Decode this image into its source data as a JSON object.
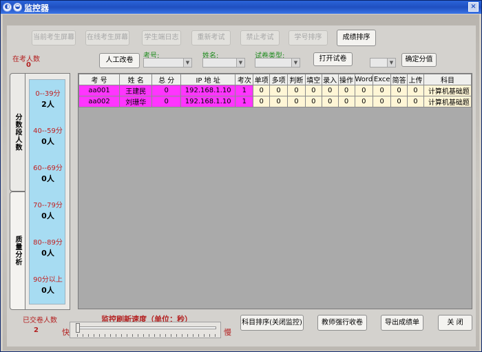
{
  "window": {
    "title": "监控器"
  },
  "toolbar": {
    "current_screen": "当前考生屏幕",
    "online_screen": "在线考生屏幕",
    "student_log": "学生端日志",
    "restart_exam": "重新考试",
    "stop_exam": "禁止考试",
    "id_sort": "学号排序",
    "score_sort": "成绩排序"
  },
  "status": {
    "in_exam_label": "在考人数",
    "in_exam_count": "0",
    "submitted_label": "已交卷人数",
    "submitted_count": "2"
  },
  "filters": {
    "manual_grade": "人工改卷",
    "exam_id_label": "考号:",
    "name_label": "姓名:",
    "paper_type_label": "试卷类型:",
    "open_paper": "打开试卷",
    "confirm_score": "确定分值"
  },
  "tabs": {
    "score_band": "分数段人数",
    "quality": "质量分析"
  },
  "score_bands": [
    {
      "range": "0--39分",
      "count": "2人"
    },
    {
      "range": "40--59分",
      "count": "0人"
    },
    {
      "range": "60--69分",
      "count": "0人"
    },
    {
      "range": "70--79分",
      "count": "0人"
    },
    {
      "range": "80--89分",
      "count": "0人"
    },
    {
      "range": "90分以上",
      "count": "0人"
    }
  ],
  "table": {
    "headers": [
      "考 号",
      "姓 名",
      "总 分",
      "IP 地 址",
      "考次",
      "单项",
      "多项",
      "判断",
      "填空",
      "录入",
      "操作",
      "Word",
      "Exce",
      "简答",
      "上传",
      "科目"
    ],
    "rows": [
      [
        "aa001",
        "王建民",
        "0",
        "192.168.1.10",
        "1",
        "0",
        "0",
        "0",
        "0",
        "0",
        "0",
        "0",
        "0",
        "0",
        "0",
        "计算机基础题"
      ],
      [
        "aa002",
        "刘珊华",
        "0",
        "192.168.1.10",
        "1",
        "0",
        "0",
        "0",
        "0",
        "0",
        "0",
        "0",
        "0",
        "0",
        "0",
        "计算机基础题"
      ]
    ]
  },
  "speed": {
    "label": "监控刷新速度（单位：秒）",
    "fast": "快",
    "slow": "慢"
  },
  "bottom_buttons": {
    "subject_sort": "科目排序(关闭监控)",
    "force_collect": "教师强行收卷",
    "export_scores": "导出成绩单",
    "close": "关 闭"
  }
}
